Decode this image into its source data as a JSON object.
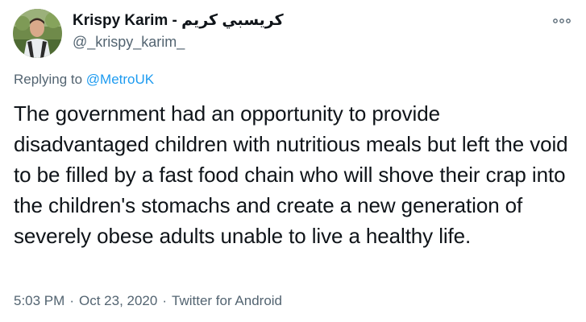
{
  "author": {
    "display_name": "Krispy Karim - كريسبي كريم",
    "handle": "@_krispy_karim_",
    "avatar_icon": "profile-photo"
  },
  "reply": {
    "prefix": "Replying to ",
    "mention": "@MetroUK"
  },
  "tweet": {
    "text": "The government had an opportunity to provide disadvantaged children with nutritious meals but left the void to be filled by a fast food chain who will shove their crap into the children's stomachs and create a new generation of severely obese adults unable to live a healthy life."
  },
  "meta": {
    "time": "5:03 PM",
    "separator": "·",
    "date": "Oct 23, 2020",
    "source": "Twitter for Android"
  },
  "menu": {
    "icon": "more-horizontal-icon"
  },
  "colors": {
    "mention": "#1d9bf0",
    "secondary_text": "#536471",
    "primary_text": "#0f1419"
  }
}
